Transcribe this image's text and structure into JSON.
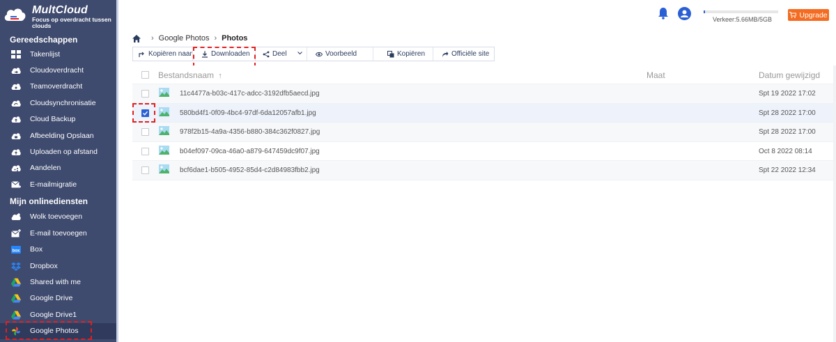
{
  "app": {
    "name": "MultCloud",
    "tagline": "Focus op overdracht tussen clouds"
  },
  "sidebar": {
    "tools_heading": "Gereedschappen",
    "tools": [
      {
        "label": "Takenlijst",
        "icon": "list-grid-icon"
      },
      {
        "label": "Cloudoverdracht",
        "icon": "cloud-transfer-icon"
      },
      {
        "label": "Teamoverdracht",
        "icon": "team-transfer-icon"
      },
      {
        "label": "Cloudsynchronisatie",
        "icon": "cloud-sync-icon"
      },
      {
        "label": "Cloud Backup",
        "icon": "cloud-backup-icon"
      },
      {
        "label": "Afbeelding Opslaan",
        "icon": "image-save-icon"
      },
      {
        "label": "Uploaden op afstand",
        "icon": "remote-upload-icon"
      },
      {
        "label": "Aandelen",
        "icon": "share-icon"
      },
      {
        "label": "E-mailmigratie",
        "icon": "email-migration-icon"
      }
    ],
    "services_heading": "Mijn onlinediensten",
    "services": [
      {
        "label": "Wolk toevoegen",
        "icon": "add-cloud-icon"
      },
      {
        "label": "E-mail toevoegen",
        "icon": "add-email-icon"
      },
      {
        "label": "Box",
        "icon": "box-icon"
      },
      {
        "label": "Dropbox",
        "icon": "dropbox-icon"
      },
      {
        "label": "Shared with me",
        "icon": "google-drive-icon"
      },
      {
        "label": "Google Drive",
        "icon": "google-drive-icon"
      },
      {
        "label": "Google Drive1",
        "icon": "google-drive-icon"
      },
      {
        "label": "Google Photos",
        "icon": "google-photos-icon",
        "active": true
      }
    ]
  },
  "topbar": {
    "quota_text": "Verkeer:5.66MB/5GB",
    "upgrade_label": "Upgrade"
  },
  "breadcrumb": {
    "root": "Google Photos",
    "current": "Photos"
  },
  "toolbar": {
    "copy_to": "Kopiëren naar",
    "download": "Downloaden",
    "share": "Deel",
    "preview": "Voorbeeld",
    "copy": "Kopiëren",
    "official_site": "Officiële site"
  },
  "table": {
    "headers": {
      "name": "Bestandsnaam",
      "size": "Maat",
      "date": "Datum gewijzigd"
    },
    "rows": [
      {
        "name": "11c4477a-b03c-417c-adcc-3192dfb5aecd.jpg",
        "size": "",
        "date": "Spt 19 2022 17:02",
        "checked": false
      },
      {
        "name": "580bd4f1-0f09-4bc4-97df-6da12057afb1.jpg",
        "size": "",
        "date": "Spt 28 2022 17:00",
        "checked": true
      },
      {
        "name": "978f2b15-4a9a-4356-b880-384c362f0827.jpg",
        "size": "",
        "date": "Spt 28 2022 17:00",
        "checked": false
      },
      {
        "name": "b04ef097-09ca-46a0-a879-647459dc9f07.jpg",
        "size": "",
        "date": "Oct 8 2022 08:14",
        "checked": false
      },
      {
        "name": "bcf6dae1-b505-4952-85d4-c2d84983fbb2.jpg",
        "size": "",
        "date": "Spt 22 2022 12:34",
        "checked": false
      }
    ]
  },
  "colors": {
    "sidebar_bg": "#3e4a6e",
    "accent": "#2b5fd4",
    "upgrade": "#f36c21",
    "highlight": "#e0201f"
  }
}
